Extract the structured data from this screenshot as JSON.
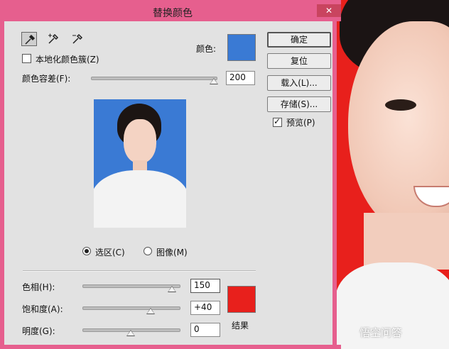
{
  "dialog": {
    "title": "替换颜色",
    "close_glyph": "✕",
    "tools": [
      "eyedropper-icon",
      "eyedropper-plus-icon",
      "eyedropper-minus-icon"
    ],
    "localized_label": "本地化颜色簇(Z)",
    "localized_checked": false,
    "color_label": "颜色:",
    "selection_color": "#3a7ad4",
    "tolerance_label": "颜色容差(F):",
    "tolerance_value": "200",
    "tolerance_fraction": 1.0,
    "view_options": [
      "选区(C)",
      "图像(M)"
    ],
    "view_selected": "选区(C)",
    "hue_label": "色相(H):",
    "hue_value": "150",
    "saturation_label": "饱和度(A):",
    "saturation_value": "+40",
    "lightness_label": "明度(G):",
    "lightness_value": "0",
    "result_label": "结果",
    "result_color": "#e8201c"
  },
  "buttons": {
    "ok": "确定",
    "reset": "复位",
    "load": "载入(L)...",
    "save": "存储(S)...",
    "preview_label": "预览(P)",
    "preview_checked": true
  },
  "watermark": "悟空问答"
}
